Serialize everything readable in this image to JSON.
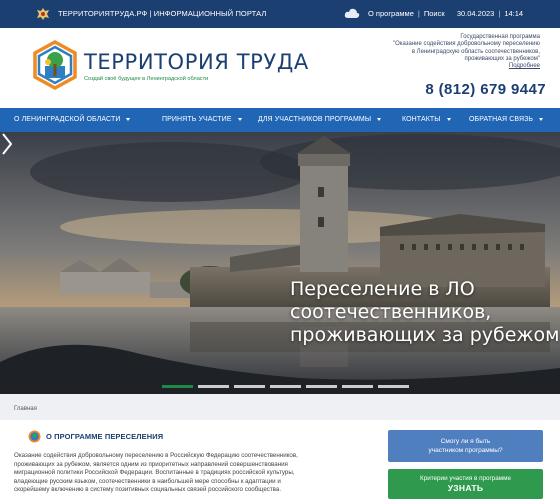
{
  "topbar": {
    "portal": "ТЕРРИТОРИЯТРУДА.РФ | ИНФОРМАЦИОННЫЙ ПОРТАЛ",
    "about_link": "О программе",
    "search_link": "Поиск",
    "date": "30.04.2023",
    "time": "14:14"
  },
  "header": {
    "logo_title": "ТЕРРИТОРИЯ ТРУДА",
    "logo_subtitle": "Создай своё будущее в Ленинградской области",
    "gov_line1": "Государственная программа",
    "gov_line2": "\"Оказание содействия добровольному переселению",
    "gov_line3": "в Ленинградскую область соотечественников,",
    "gov_line4": "проживающих за рубежом\"",
    "gov_more": "Подробнее",
    "phone": "8 (812) 679 9447"
  },
  "nav": {
    "items": [
      "О ЛЕНИНГРАДСКОЙ ОБЛАСТИ",
      "ПРИНЯТЬ УЧАСТИЕ",
      "ДЛЯ УЧАСТНИКОВ ПРОГРАММЫ",
      "КОНТАКТЫ",
      "ОБРАТНАЯ СВЯЗЬ"
    ]
  },
  "hero": {
    "line1": "Переселение в ЛО",
    "line2": "соотечественников,",
    "line3": "проживающих за рубежом",
    "active_slide": 1,
    "slide_count": 7
  },
  "breadcrumb": "Главная",
  "about": {
    "heading": "О ПРОГРАММЕ ПЕРЕСЕЛЕНИЯ",
    "line1": "Оказание содействия добровольному переселению в Российскую Федерацию соотечественников,",
    "line2": "проживающих за рубежом, является одним из приоритетных направлений совершенствования",
    "line3": "миграционной политики Российской Федерации. Воспитанные в традициях российской культуры,",
    "line4": "владеющие русским языком, соотечественники в наибольшей мере способны к адаптации и",
    "line5": "скорейшему включению в систему позитивных социальных связей российского сообщества."
  },
  "buttons": {
    "participant_line1": "Смогу ли я быть",
    "participant_line2": "участником программы?",
    "criteria_small": "Критерии участия в программе",
    "criteria_big": "УЗНАТЬ"
  },
  "colors": {
    "topbar": "#1c3f72",
    "nav": "#2166b5",
    "accent_green": "#1f8a47",
    "button_blue": "#4f7fbf",
    "button_green": "#2f9a4e"
  },
  "icons": [
    "emblem-icon",
    "cloud-icon",
    "logo-icon",
    "chevron-down-icon",
    "chevron-right-icon",
    "program-icon"
  ]
}
